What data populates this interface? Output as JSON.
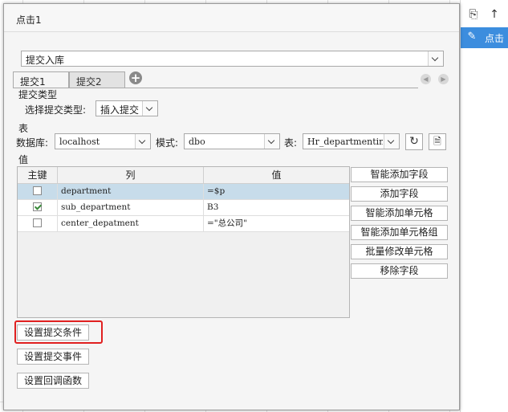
{
  "dialog": {
    "title": "点击1"
  },
  "right_panel": {
    "action_text": "点击"
  },
  "submit_type_dropdown": {
    "value": "提交入库"
  },
  "tabs": [
    {
      "label": "提交1"
    },
    {
      "label": "提交2"
    }
  ],
  "section_submit_type": {
    "heading": "提交类型",
    "select_label": "选择提交类型:",
    "select_value": "插入提交"
  },
  "section_table": {
    "heading": "表",
    "db_label": "数据库:",
    "db_value": "localhost",
    "schema_label": "模式:",
    "schema_value": "dbo",
    "table_label": "表:",
    "table_value": "Hr_departmentin:"
  },
  "section_values": {
    "heading": "值",
    "columns": [
      "主键",
      "列",
      "值"
    ],
    "rows": [
      {
        "key": false,
        "column": "department",
        "value": "=$p"
      },
      {
        "key": true,
        "column": "sub_department",
        "value": "B3"
      },
      {
        "key": false,
        "column": "center_depatment",
        "value": "=\"总公司\""
      }
    ]
  },
  "side_buttons": [
    "智能添加字段",
    "添加字段",
    "智能添加单元格",
    "智能添加单元格组",
    "批量修改单元格",
    "移除字段"
  ],
  "bottom_buttons": {
    "condition": "设置提交条件",
    "event": "设置提交事件",
    "callback": "设置回调函数"
  },
  "colors": {
    "accent": "#3c8dde",
    "highlight": "#e02020",
    "selected_row": "#c7dcea"
  }
}
